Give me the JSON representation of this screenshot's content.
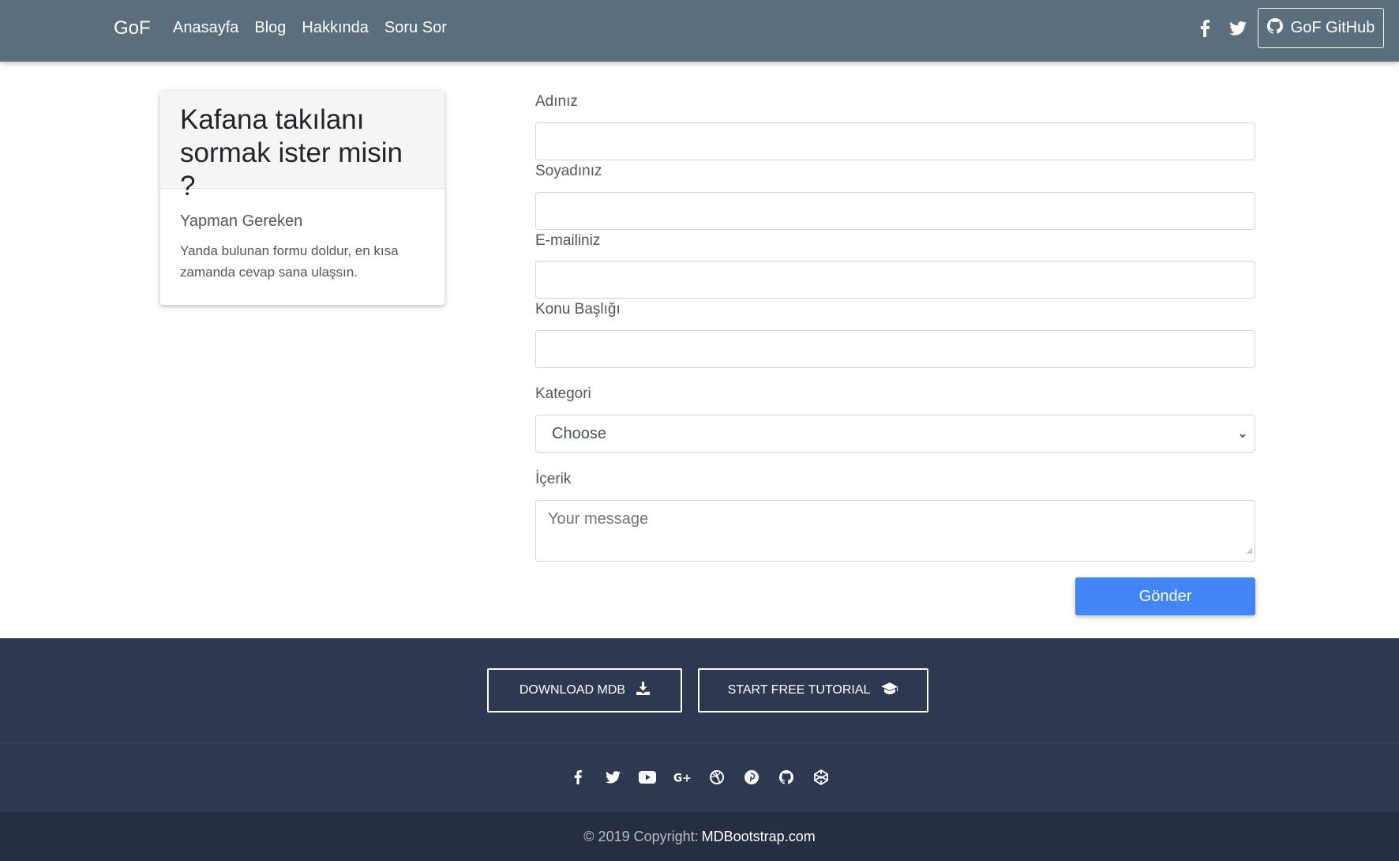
{
  "navbar": {
    "brand": "GoF",
    "links": [
      "Anasayfa",
      "Blog",
      "Hakkında",
      "Soru Sor"
    ],
    "github_label": "GoF GitHub",
    "icons": [
      "facebook-icon",
      "twitter-icon",
      "github-icon"
    ]
  },
  "card": {
    "title": "Kafana takılanı sormak ister misin ?",
    "subtitle": "Yapman Gereken",
    "text": "Yanda bulunan formu doldur, en kısa zamanda cevap sana ulaşsın."
  },
  "form": {
    "first_name_label": "Adınız",
    "last_name_label": "Soyadınız",
    "email_label": "E-mailiniz",
    "subject_label": "Konu Başlığı",
    "category_label": "Kategori",
    "category_value": "Choose",
    "content_label": "İçerik",
    "content_placeholder": "Your message",
    "submit_label": "Gönder"
  },
  "footer": {
    "download_label": "DOWNLOAD MDB",
    "tutorial_label": "START FREE TUTORIAL",
    "social_icons": [
      "facebook-icon",
      "twitter-icon",
      "youtube-icon",
      "google-plus-icon",
      "dribbble-icon",
      "pinterest-icon",
      "github-icon",
      "codepen-icon"
    ],
    "copyright_text": "© 2019 Copyright:",
    "copyright_link": "MDBootstrap.com"
  },
  "colors": {
    "navbar": "#5a6e7d",
    "primary": "#4285f4",
    "footer": "#2e3951",
    "footer_bottom": "#252e43"
  }
}
